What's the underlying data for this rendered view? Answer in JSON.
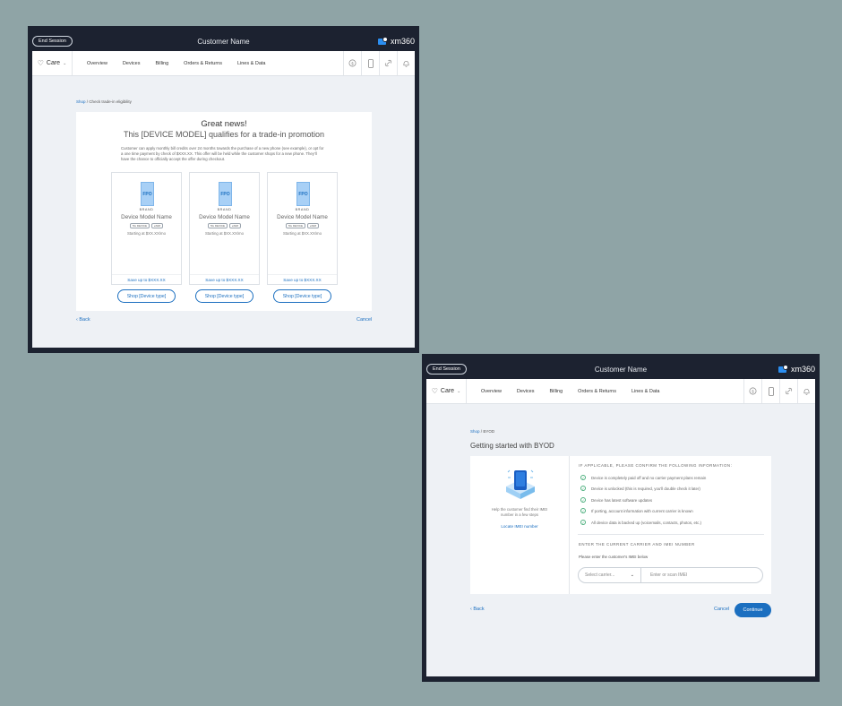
{
  "header": {
    "end_session": "End Session",
    "customer_name": "Customer Name",
    "brand": "xm360"
  },
  "nav": {
    "care": "Care",
    "tabs": [
      "Overview",
      "Devices",
      "Billing",
      "Orders & Returns",
      "Lines & Data"
    ]
  },
  "screen1": {
    "breadcrumb": {
      "root": "Shop",
      "sep": "/",
      "current": "Check trade-in eligibility"
    },
    "heading1": "Great news!",
    "heading2": "This [DEVICE MODEL] qualifies for a trade-in promotion",
    "paragraph": "Customer can apply monthly bill credits over 24 months towards the purchase of a new phone (see example), or opt for a one time payment by check of $XXX.XX. This offer will be held while the customer shops for a new phone. They'll have the chance to officially accept the offer during checkout.",
    "devices": [
      {
        "fpo": "FPO",
        "brand": "BRAND",
        "model": "Device Model Name",
        "tags": [
          "5G DEVICE",
          "eSIM"
        ],
        "price": "Starting at $XX.XX/mo",
        "save": "Save up to $XXX.XX",
        "shop": "Shop [Device type]"
      },
      {
        "fpo": "FPO",
        "brand": "BRAND",
        "model": "Device Model Name",
        "tags": [
          "5G DEVICE",
          "eSIM"
        ],
        "price": "Starting at $XX.XX/mo",
        "save": "Save up to $XXX.XX",
        "shop": "Shop [Device type]"
      },
      {
        "fpo": "FPO",
        "brand": "BRAND",
        "model": "Device Model Name",
        "tags": [
          "5G DEVICE",
          "eSIM"
        ],
        "price": "Starting at $XX.XX/mo",
        "save": "Save up to $XXX.XX",
        "shop": "Shop [Device type]"
      }
    ],
    "back": "Back",
    "cancel": "Cancel"
  },
  "screen2": {
    "breadcrumb": {
      "root": "Shop",
      "sep": "/",
      "current": "BYOD"
    },
    "title": "Getting started with BYOD",
    "help_text": "Help the customer find their IMEI number in a few steps",
    "locate_link": "Locate IMEI number",
    "confirm_heading": "IF APPLICABLE, PLEASE CONFIRM THE FOLLOWING INFORMATION:",
    "checks": [
      "Device is completely paid off and no carrier payment plans remain",
      "Device is unlocked (this is required, you'll double check it later)",
      "Device has latest software updates",
      "If porting, account information with current carrier is known",
      "All device data is backed up (voicemails, contacts, photos, etc.)"
    ],
    "imei_heading": "ENTER THE CURRENT CARRIER AND IMEI NUMBER",
    "imei_label": "Please enter the customer's IMEI below",
    "carrier_placeholder": "Select carrier...",
    "imei_placeholder": "Enter or scan IMEI",
    "back": "Back",
    "cancel": "Cancel",
    "continue": "Continue"
  },
  "colors": {
    "frame": "#1c2230",
    "accent": "#1b6fc0",
    "bg": "#8fa4a6",
    "check": "#4caf7d"
  },
  "icons": [
    "heart-icon",
    "dollar-icon",
    "phone-icon",
    "link-icon",
    "bell-icon",
    "check-circle-icon",
    "chevron-left-icon",
    "chevron-down-icon"
  ]
}
